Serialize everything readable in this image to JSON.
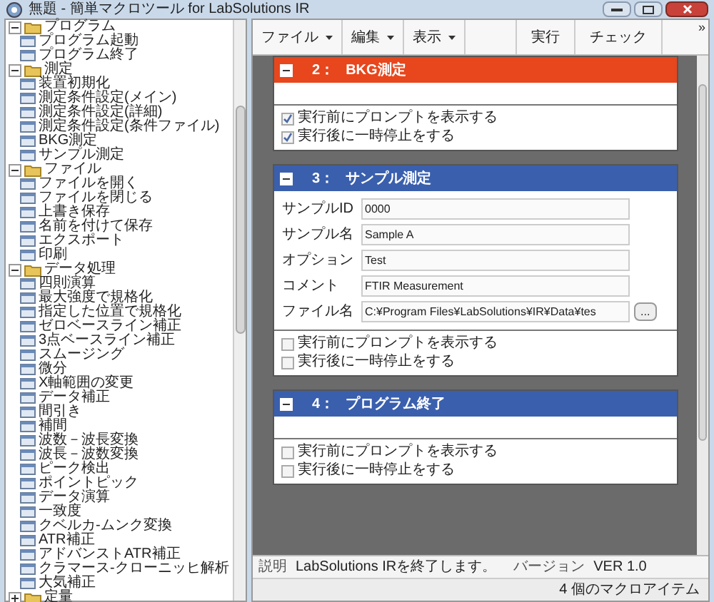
{
  "window": {
    "title": "無題 - 簡単マクロツール for LabSolutions IR"
  },
  "tree": [
    {
      "label": "プログラム",
      "expanded": true,
      "children": [
        {
          "label": "プログラム起動"
        },
        {
          "label": "プログラム終了"
        }
      ]
    },
    {
      "label": "測定",
      "expanded": true,
      "children": [
        {
          "label": "装置初期化"
        },
        {
          "label": "測定条件設定(メイン)"
        },
        {
          "label": "測定条件設定(詳細)"
        },
        {
          "label": "測定条件設定(条件ファイル)"
        },
        {
          "label": "BKG測定"
        },
        {
          "label": "サンプル測定"
        }
      ]
    },
    {
      "label": "ファイル",
      "expanded": true,
      "children": [
        {
          "label": "ファイルを開く"
        },
        {
          "label": "ファイルを閉じる"
        },
        {
          "label": "上書き保存"
        },
        {
          "label": "名前を付けて保存"
        },
        {
          "label": "エクスポート"
        },
        {
          "label": "印刷"
        }
      ]
    },
    {
      "label": "データ処理",
      "expanded": true,
      "children": [
        {
          "label": "四則演算"
        },
        {
          "label": "最大強度で規格化"
        },
        {
          "label": "指定した位置で規格化"
        },
        {
          "label": "ゼロベースライン補正"
        },
        {
          "label": "3点ベースライン補正"
        },
        {
          "label": "スムージング"
        },
        {
          "label": "微分"
        },
        {
          "label": "X軸範囲の変更"
        },
        {
          "label": "データ補正"
        },
        {
          "label": "間引き"
        },
        {
          "label": "補間"
        },
        {
          "label": "波数－波長変換"
        },
        {
          "label": "波長－波数変換"
        },
        {
          "label": "ピーク検出"
        },
        {
          "label": "ポイントピック"
        },
        {
          "label": "データ演算"
        },
        {
          "label": "一致度"
        },
        {
          "label": "クベルカ-ムンク変換"
        },
        {
          "label": "ATR補正"
        },
        {
          "label": "アドバンストATR補正"
        },
        {
          "label": "クラマース-クローニッヒ解析"
        },
        {
          "label": "大気補正"
        }
      ]
    },
    {
      "label": "定量",
      "expanded": false
    }
  ],
  "description": {
    "label": "説明",
    "text": "LabSolutions IRを終了します。"
  },
  "version": {
    "label": "バージョン",
    "text": "VER 1.0"
  },
  "toolbar": [
    {
      "kind": "menu",
      "label": "ファイル"
    },
    {
      "kind": "menu",
      "label": "編集"
    },
    {
      "kind": "menu",
      "label": "表示"
    },
    {
      "kind": "spacer"
    },
    {
      "kind": "button",
      "label": "実行"
    },
    {
      "kind": "button",
      "label": "チェック"
    }
  ],
  "toolbar_overflow": "»",
  "macros": [
    {
      "number": "2：",
      "title": "BKG測定",
      "color": "#e8461c",
      "options": [
        {
          "label": "実行前にプロンプトを表示する",
          "checked": true
        },
        {
          "label": "実行後に一時停止をする",
          "checked": true
        }
      ]
    },
    {
      "number": "3：",
      "title": "サンプル測定",
      "color": "#3a5fad",
      "fields": [
        {
          "label": "サンプルID",
          "value": "0000"
        },
        {
          "label": "サンプル名",
          "value": "Sample A"
        },
        {
          "label": "オプション",
          "value": "Test"
        },
        {
          "label": "コメント",
          "value": "FTIR Measurement"
        },
        {
          "label": "ファイル名",
          "value": "C:¥Program Files¥LabSolutions¥IR¥Data¥tes",
          "browse": "..."
        }
      ],
      "options": [
        {
          "label": "実行前にプロンプトを表示する",
          "checked": false
        },
        {
          "label": "実行後に一時停止をする",
          "checked": false
        }
      ]
    },
    {
      "number": "4：",
      "title": "プログラム終了",
      "color": "#3a5fad",
      "options": [
        {
          "label": "実行前にプロンプトを表示する",
          "checked": false
        },
        {
          "label": "実行後に一時停止をする",
          "checked": false
        }
      ]
    }
  ],
  "status_bar": "4 個のマクロアイテム"
}
